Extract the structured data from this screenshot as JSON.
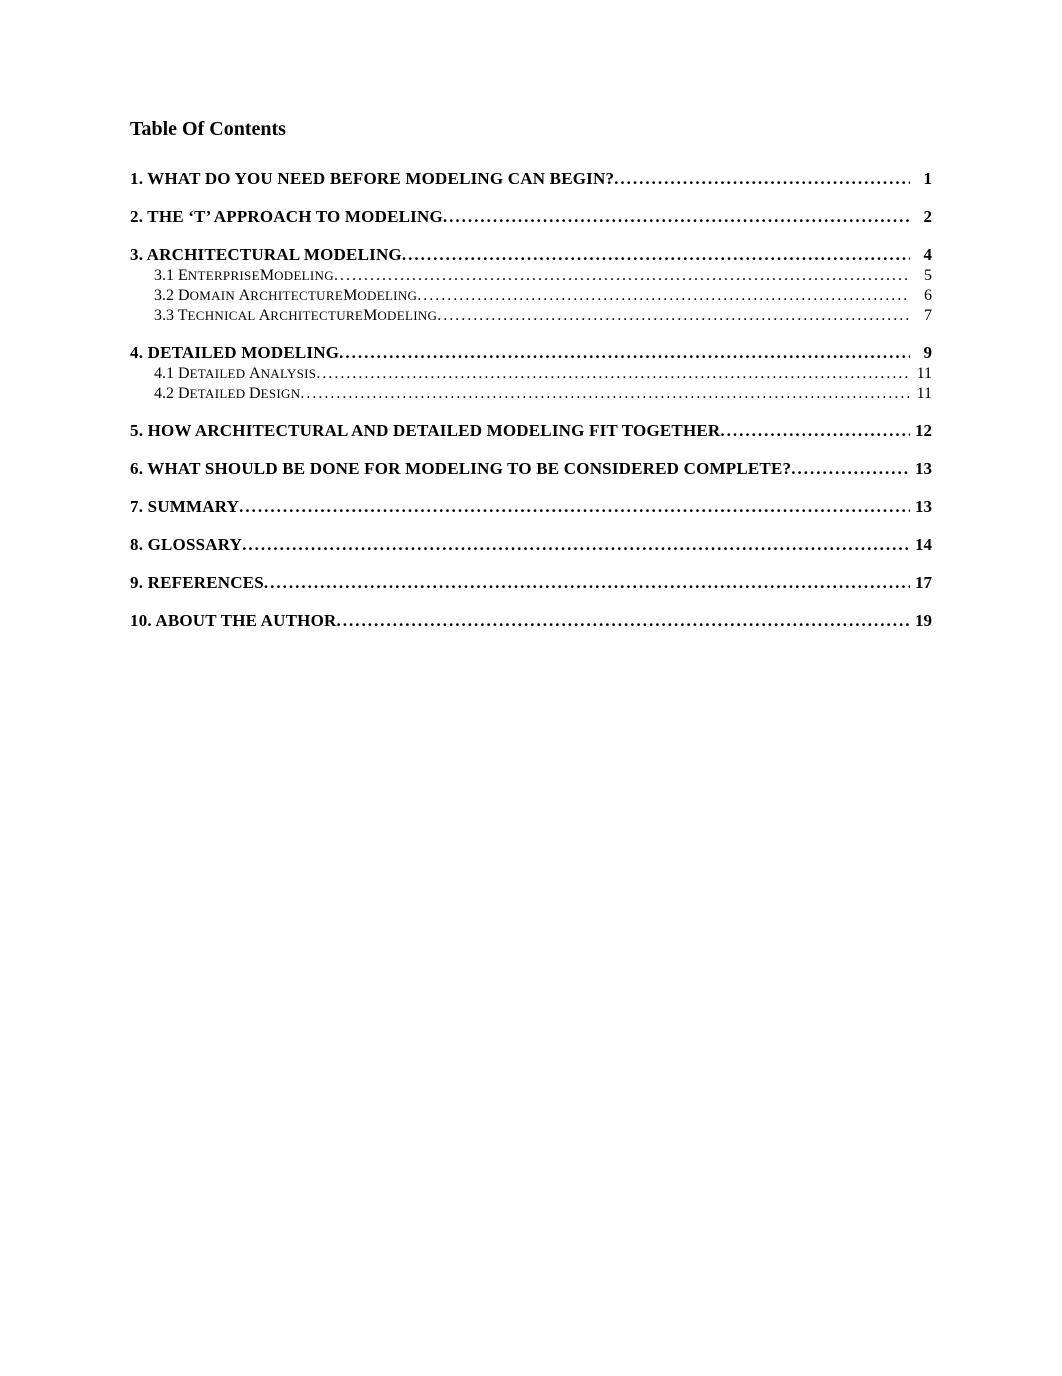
{
  "title": "Table Of Contents",
  "dots": "........................................................................................................................................................................................................................................................",
  "entries": [
    {
      "level": 1,
      "label": "1. WHAT DO YOU NEED BEFORE MODELING CAN BEGIN?",
      "page": "1"
    },
    {
      "level": 1,
      "label": "2. THE ‘T’ APPROACH TO MODELING",
      "page": "2"
    },
    {
      "level": 1,
      "label": "3. ARCHITECTURAL MODELING",
      "page": "4"
    },
    {
      "level": 2,
      "label_sc": [
        [
          "3.1 ",
          ""
        ],
        [
          "E",
          "NTERPRISE"
        ],
        [
          "M",
          "ODELING"
        ]
      ],
      "page": "5"
    },
    {
      "level": 2,
      "label_sc": [
        [
          "3.2 ",
          ""
        ],
        [
          "D",
          "OMAIN "
        ],
        [
          "A",
          "RCHITECTURE"
        ],
        [
          "M",
          "ODELING"
        ]
      ],
      "page": "6"
    },
    {
      "level": 2,
      "label_sc": [
        [
          "3.3 ",
          ""
        ],
        [
          "T",
          "ECHNICAL "
        ],
        [
          "A",
          "RCHITECTURE"
        ],
        [
          "M",
          "ODELING"
        ]
      ],
      "page": "7"
    },
    {
      "level": 1,
      "label": "4. DETAILED MODELING",
      "page": "9"
    },
    {
      "level": 2,
      "label_sc": [
        [
          "4.1 ",
          ""
        ],
        [
          "D",
          "ETAILED "
        ],
        [
          "A",
          "NALYSIS"
        ]
      ],
      "page": "11"
    },
    {
      "level": 2,
      "label_sc": [
        [
          "4.2 ",
          ""
        ],
        [
          "D",
          "ETAILED "
        ],
        [
          "D",
          "ESIGN"
        ]
      ],
      "page": "11"
    },
    {
      "level": 1,
      "label": "5. HOW ARCHITECTURAL AND DETAILED MODELING FIT TOGETHER",
      "page": "12"
    },
    {
      "level": 1,
      "label": "6. WHAT SHOULD BE DONE FOR MODELING TO BE CONSIDERED COMPLETE?",
      "page": "13"
    },
    {
      "level": 1,
      "label": "7. SUMMARY",
      "page": "13"
    },
    {
      "level": 1,
      "label": "8. GLOSSARY",
      "page": "14"
    },
    {
      "level": 1,
      "label": "9. REFERENCES",
      "page": "17"
    },
    {
      "level": 1,
      "label": "10. ABOUT THE AUTHOR",
      "page": "19"
    }
  ]
}
